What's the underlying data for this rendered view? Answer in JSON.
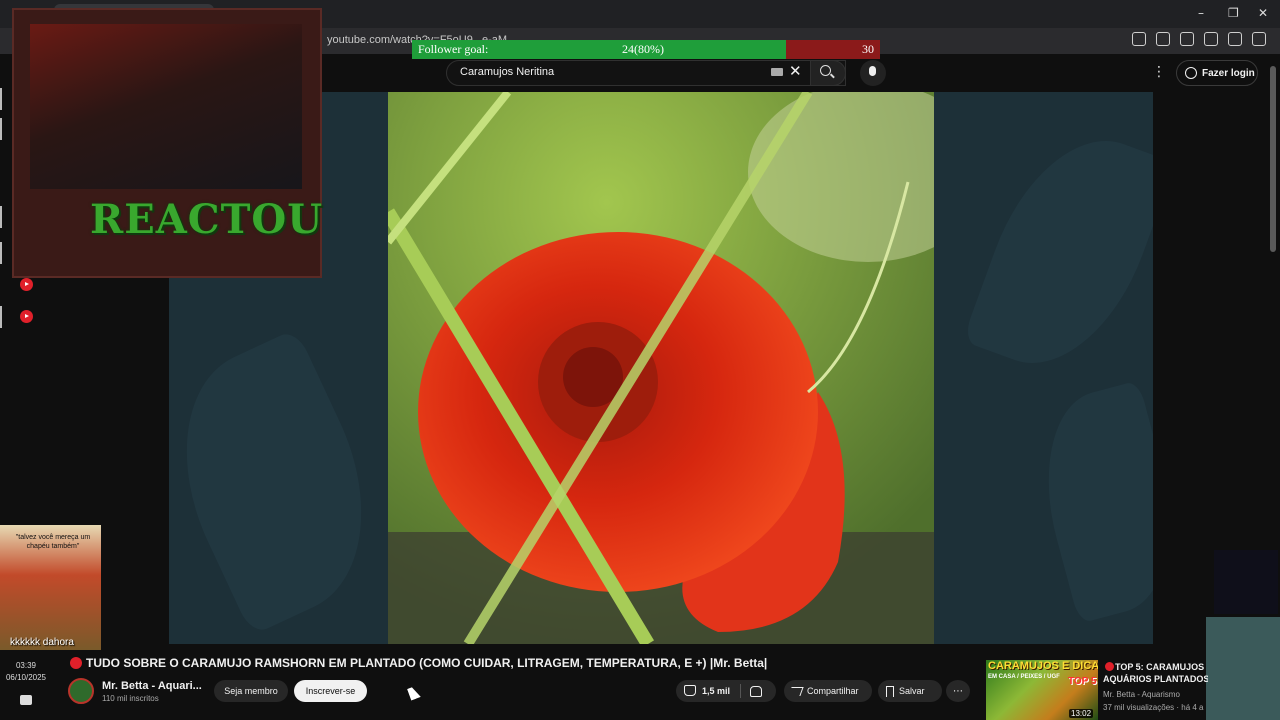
{
  "browser": {
    "url": "youtube.com/watch?v=F5oU9...e-aM",
    "window_controls": [
      "–",
      "❐",
      "✕"
    ]
  },
  "follower_goal": {
    "label": "Follower goal:",
    "current_text": "24(80%)",
    "target": "30",
    "progress": 0.8,
    "fill_color": "#1f9e3a",
    "track_color": "#8b1a1a"
  },
  "youtube_header": {
    "search_query": "Caramujos Neritina",
    "clear_symbol": "✕",
    "login_label": "Fazer login",
    "menu_symbol": "⋮"
  },
  "overlay": {
    "brand_text": "REACTOU",
    "meme_caption": "\"talvez você mereça um chapéu também\"",
    "meme_bottom_text": "kkkkkk dahora",
    "clock_time": "03:39",
    "clock_date": "06/10/2025"
  },
  "video": {
    "title": "TUDO SOBRE O CARAMUJO RAMSHORN EM PLANTADO (COMO CUIDAR, LITRAGEM, TEMPERATURA, E +) |Mr. Betta|",
    "channel_name": "Mr. Betta - Aquari...",
    "subscribers": "110 mil inscritos",
    "member_label": "Seja membro",
    "subscribe_label": "Inscrever-se",
    "like_count": "1,5 mil",
    "share_label": "Compartilhar",
    "save_label": "Salvar",
    "more_symbol": "⋯"
  },
  "recommendation": {
    "thumb_text": "CARAMUJOS E DICAS",
    "thumb_subtext": "EM CASA / PEIXES / UGF",
    "thumb_badge": "TOP 5",
    "duration": "13:02",
    "title_line1": "TOP 5: CARAMUJOS",
    "title_line2": "AQUÁRIOS PLANTADOS",
    "channel": "Mr. Betta - Aquarismo",
    "meta": "37 mil visualizações · há 4 a"
  },
  "colors": {
    "accent_red": "#e0202a",
    "youtube_bg": "#0f0f0f",
    "player_bg": "#1d3038",
    "brand_green": "#39a82e"
  }
}
